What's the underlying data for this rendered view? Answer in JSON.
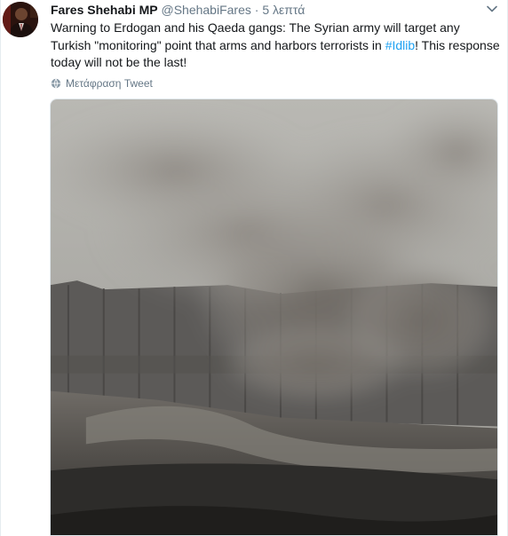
{
  "tweet": {
    "author_name": "Fares Shehabi MP",
    "handle": "@ShehabiFares",
    "separator": "·",
    "time": "5 λεπτά",
    "text_before": "Warning to Erdogan and his Qaeda gangs: The Syrian army will target any Turkish \"monitoring\" point that arms and harbors terrorists in ",
    "hashtag": "#Idlib",
    "text_after": "! This response today will not be the last!",
    "translate_label": "Μετάφραση Tweet",
    "icons": {
      "avatar": "avatar",
      "menu": "chevron-down-icon",
      "translate": "globe-icon"
    },
    "colors": {
      "link": "#1da1f2",
      "secondary_text": "#657786",
      "primary_text": "#14171a"
    }
  }
}
